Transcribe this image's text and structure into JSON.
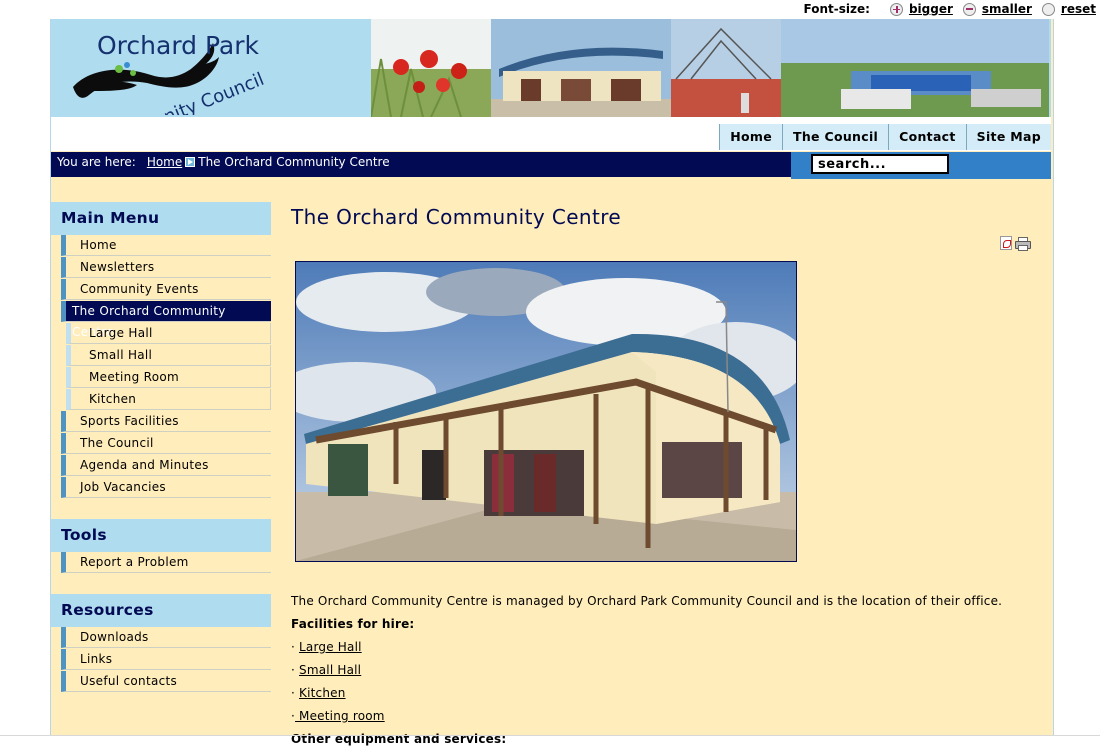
{
  "font_size_bar": {
    "label": "Font-size:",
    "bigger": "bigger",
    "smaller": "smaller",
    "reset": "reset"
  },
  "header": {
    "logo_line1": "Orchard Park",
    "logo_line2": "Community Council"
  },
  "top_nav": [
    "Home",
    "The Council",
    "Contact",
    "Site Map"
  ],
  "breadcrumb": {
    "prefix": "You are here:",
    "home": "Home",
    "current": "The Orchard Community Centre"
  },
  "search": {
    "placeholder": "search..."
  },
  "sidebar": {
    "main_menu": {
      "title": "Main Menu",
      "items": [
        {
          "label": "Home",
          "level": 0
        },
        {
          "label": "Newsletters",
          "level": 0
        },
        {
          "label": "Community Events",
          "level": 0
        },
        {
          "label": "The Orchard Community Centre",
          "level": 0,
          "active": true
        },
        {
          "label": "Large Hall",
          "level": 1
        },
        {
          "label": "Small Hall",
          "level": 1
        },
        {
          "label": "Meeting Room",
          "level": 1
        },
        {
          "label": "Kitchen",
          "level": 1
        },
        {
          "label": "Sports Facilities",
          "level": 0
        },
        {
          "label": "The Council",
          "level": 0
        },
        {
          "label": "Agenda and Minutes",
          "level": 0
        },
        {
          "label": "Job Vacancies",
          "level": 0
        }
      ]
    },
    "tools": {
      "title": "Tools",
      "items": [
        "Report a Problem"
      ]
    },
    "resources": {
      "title": "Resources",
      "items": [
        "Downloads",
        "Links",
        "Useful contacts"
      ]
    }
  },
  "content": {
    "title": "The Orchard Community Centre",
    "intro": "The Orchard Community Centre is managed by Orchard Park Community Council and is the location of their office.",
    "facilities_heading": "Facilities for hire:",
    "facilities": [
      {
        "bullet": "·",
        "link": "Large Hall"
      },
      {
        "bullet": "·",
        "link": "Small Hall"
      },
      {
        "bullet": "·",
        "link": "Kitchen"
      },
      {
        "bullet": "·",
        "link": " Meeting room"
      }
    ],
    "other_heading": "Other equipment and services:"
  },
  "colors": {
    "header_blue": "#b0dcef",
    "navy": "#010a52",
    "search_blue": "#3280c8",
    "page_background": "#ffedbb",
    "menu_border": "#4f93c2"
  }
}
